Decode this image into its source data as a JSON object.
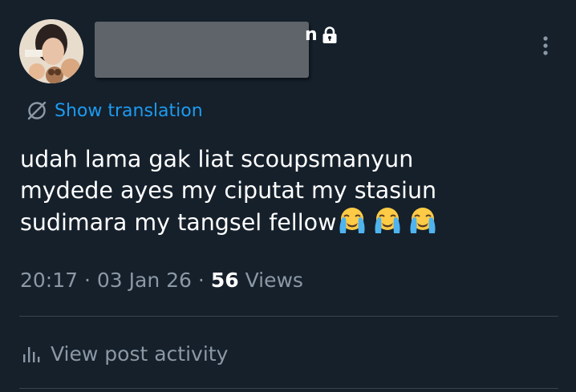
{
  "header": {
    "name_visible_tail": "n",
    "avatar_icon": "profile-photo",
    "lock_icon": "lock-icon",
    "more_icon": "more-vertical-icon"
  },
  "translation": {
    "icon": "translate-icon",
    "label": "Show translation"
  },
  "post": {
    "lines": [
      "udah lama gak liat scoupsmanyun",
      "mydede ayes my ciputat my stasiun",
      "sudimara my tangsel fellow"
    ],
    "emoji": "loudly-crying-face",
    "emoji_count": 3
  },
  "meta": {
    "time": "20:17",
    "separator": "·",
    "date": "03 Jan 26",
    "view_count": "56",
    "views_label": "Views"
  },
  "activity": {
    "icon": "bar-chart-icon",
    "label": "View post activity"
  },
  "colors": {
    "background": "#15202b",
    "accent": "#1d9bf0",
    "secondary_text": "#8b98a5",
    "divider": "#38444d"
  }
}
